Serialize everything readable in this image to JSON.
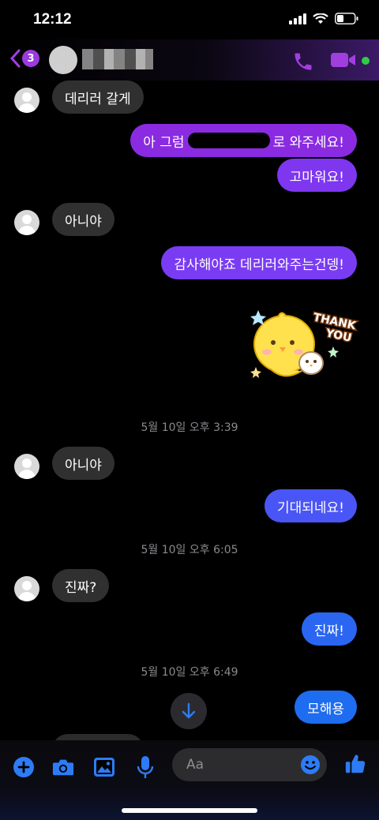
{
  "status": {
    "time": "12:12",
    "icons": [
      "signal-icon",
      "wifi-icon",
      "battery-icon"
    ]
  },
  "header": {
    "unread_badge": "3",
    "icons": [
      "back-chevron-icon",
      "phone-icon",
      "video-camera-icon"
    ]
  },
  "messages": [
    {
      "dir": "in",
      "text": "데리러 갈게"
    },
    {
      "dir": "out",
      "prefix": "아 그럼",
      "suffix": "로 와주세요!"
    },
    {
      "dir": "out",
      "text": "고마워요!"
    },
    {
      "dir": "in",
      "text": "아니야"
    },
    {
      "dir": "out",
      "text": "감사해야죠 데리러와주는건뎅!"
    },
    {
      "dir": "out",
      "type": "sticker",
      "sticker_text": "THANK YOU"
    },
    {
      "type": "timestamp",
      "text": "5월 10일 오후 3:39"
    },
    {
      "dir": "in",
      "text": "아니야"
    },
    {
      "dir": "out",
      "text": "기대되네요!"
    },
    {
      "type": "timestamp",
      "text": "5월 10일 오후 6:05"
    },
    {
      "dir": "in",
      "text": "진짜?"
    },
    {
      "dir": "out",
      "text": "진짜!"
    },
    {
      "type": "timestamp",
      "text": "5월 10일 오후 6:49"
    },
    {
      "dir": "out",
      "text": "모해용"
    }
  ],
  "composer": {
    "placeholder": "Aa",
    "icons": [
      "plus-icon",
      "camera-icon",
      "image-icon",
      "microphone-icon",
      "emoji-icon",
      "thumbs-up-icon"
    ]
  },
  "colors": {
    "purple": "#8a2be2",
    "blue": "#1e6cf0",
    "incoming": "#303030"
  }
}
